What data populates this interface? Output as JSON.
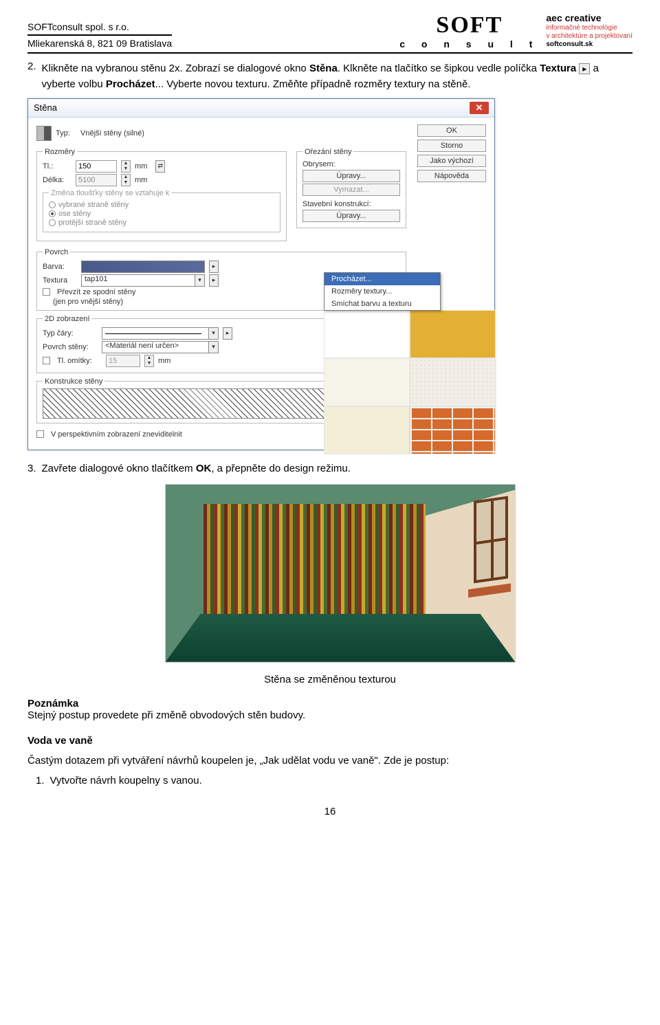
{
  "header": {
    "company": "SOFTconsult spol. s r.o.",
    "address": "Mliekarenská 8, 821 09 Bratislava",
    "logo1_big": "SOFT",
    "logo1_sub": "c o n s u l t",
    "logo2_l1": "aec creative",
    "logo2_l2": "informačné technológie",
    "logo2_l3": "v architektúre a projektovaní",
    "logo2_l4": "softconsult.sk"
  },
  "step2_a": "Klikněte na vybranou stěnu 2x. Zobrazí se dialogové okno ",
  "step2_b": "Stěna",
  "step2_c": ". Klkněte na tlačítko se šipkou vedle políčka ",
  "step2_d": "Textura",
  "step2_e": " a vyberte volbu ",
  "step2_f": "Procházet",
  "step2_g": "... Vyberte novou texturu. Změňte případně rozměry textury na stěně.",
  "dialog": {
    "title": "Stěna",
    "typ_label": "Typ:",
    "typ_value": "Vnější stěny (silné)",
    "buttons": {
      "ok": "OK",
      "storno": "Storno",
      "vychozi": "Jako výchozí",
      "napoveda": "Nápověda"
    },
    "rozmery": "Rozměry",
    "tl_label": "Tl.:",
    "tl_value": "150",
    "mm": "mm",
    "delka_label": "Délka:",
    "delka_value": "5100",
    "orezani": "Ořezání stěny",
    "obrysem": "Obrysem:",
    "upravy": "Úpravy...",
    "vymazat": "Vymazat...",
    "stav_kon": "Stavební konstrukcí:",
    "zmena_title": "Změna tloušťky stěny se vztahuje k",
    "r1": "vybrané straně stěny",
    "r2": "ose stěny",
    "r3": "protější straně stěny",
    "povrch": "Povrch",
    "barva": "Barva:",
    "textura_label": "Textura",
    "textura_value": "tap101",
    "prevzit": "Převzít ze spodní stěny",
    "jen_pro": "(jen pro vnější stěny)",
    "menu_prochazet": "Procházet...",
    "menu_rozmery": "Rozměry textury...",
    "menu_smichat": "Smíchat barvu a texturu",
    "zobr2d": "2D zobrazení",
    "typ_cary": "Typ čáry:",
    "povrch_steny": "Povrch stěny:",
    "povrch_steny_val": "<Materiál není určen>",
    "tl_omitky": "Tl. omítky:",
    "tl_omitky_val": "15",
    "konstrukce": "Konstrukce stěny",
    "persp": "V perspektivním zobrazení zneviditelnit"
  },
  "step3_a": "Zavřete dialogové okno tlačítkem ",
  "step3_b": "OK",
  "step3_c": ", a přepněte do design režimu.",
  "caption": "Stěna se změněnou texturou",
  "note_h": "Poznámka",
  "note_t": "Stejný postup provedete při změně obvodových stěn budovy.",
  "voda_h": "Voda ve vaně",
  "voda_t": "Častým dotazem při vytváření návrhů koupelen je, „Jak udělat vodu ve vaně\". Zde je postup:",
  "voda_step1": "Vytvořte návrh koupelny s vanou.",
  "page_num": "16",
  "step2_num": "2.",
  "step3_num": "3.",
  "voda1_num": "1."
}
